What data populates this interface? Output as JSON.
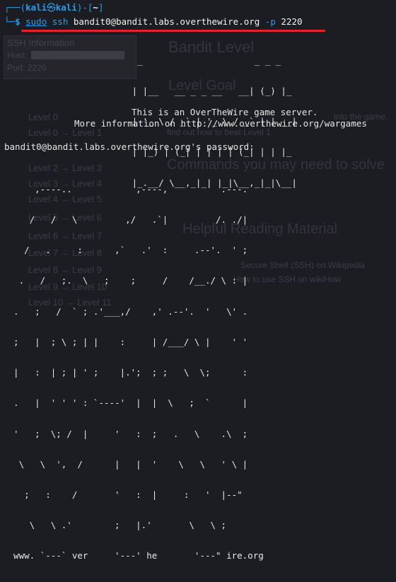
{
  "background_page": {
    "ssh_box": {
      "title": "SSH Information",
      "host_label": "Host:",
      "port_label": "Port: 2220"
    },
    "level_title": "Bandit Level",
    "level_goal": "Level Goal",
    "goal_text_1": "into the game.",
    "goal_text_2": "find out how to beat Level 1.",
    "commands_heading": "Commands you may need to solve",
    "reading_heading": "Helpful Reading Material",
    "reading_link_1": "Secure Shell (SSH) on Wikipedia",
    "reading_link_2": "How to use SSH on wikiHow",
    "nav": [
      "Level 0",
      "Level 0 → Level 1",
      "Level 2 → Level 3",
      "Level 3 → Level 4",
      "Level 4 → Level 5",
      "Level 5 → Level 6",
      "Level 6 → Level 7",
      "Level 7 → Level 8",
      "Level 8 → Level 9",
      "Level 9 → Level 10",
      "Level 10 → Level 11"
    ]
  },
  "terminal": {
    "prompt_top_open": "┌──(",
    "user": "kali",
    "at_symbol": "㉿",
    "host": "kali",
    "prompt_top_mid": ")-[",
    "cwd": "~",
    "prompt_top_close": "]",
    "prompt_bottom": "└─",
    "dollar": "$",
    "cmd_sudo": "sudo",
    "cmd_ssh": "ssh",
    "cmd_target": "bandit0@bandit.labs.overthewire.org",
    "cmd_flag": "-p",
    "cmd_port": "2220",
    "bandit_banner": [
      "                         _                     _ _ _   ",
      "                        | |__   __ _ _ __   __| (_) |_ ",
      "                        | '_ \\ / _` | '_ \\ / _` | | __|",
      "                        | |_) | (_| | | | | (_| | | |_ ",
      "                        |_.__/ \\__,_|_| |_|\\__,_|_|\\__|"
    ],
    "server_msg": "This is an OverTheWire game server.",
    "more_info": "More information on http://www.overthewire.org/wargames",
    "password_prompt": "bandit0@bandit.labs.overthewire.org's password:",
    "otw_art": [
      "      ,----..            ,----,          .---.",
      "     /   /   \\         ,/   .`|         /. ./|",
      "    /   .     :      ,`   .'  :     .--'.  ' ;",
      "   .   /   ;.  \\   ;    ;     /    /__./ \\ : |",
      "  .   ;   /  ` ; .'___,/    ,' .--'.  '   \\' .",
      "  ;   |  ; \\ ; | |    :     | /___/ \\ |    ' '",
      "  |   :  | ; | ' ;    |.';  ; ;   \\  \\;      :",
      "  .   |  ' ' ' : `----'  |  |  \\   ;  `      |",
      "  '   ;  \\; /  |     '   :  ;   .   \\    .\\  ;",
      "   \\   \\  ',  /      |   |  '    \\   \\   ' \\ |",
      "    ;   :    /       '   :  |     :   '  |--\"",
      "     \\   \\ .'        ;   |.'       \\   \\ ;",
      "  www. `---` ver     '---' he       '---\" ire.org"
    ]
  }
}
